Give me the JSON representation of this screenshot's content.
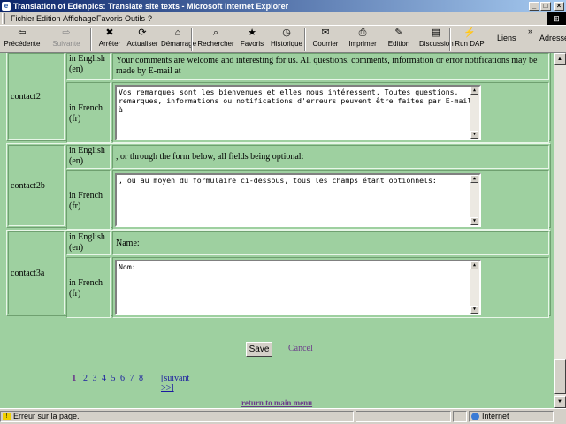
{
  "window": {
    "title": "Translation of Edenpics: Translate site texts - Microsoft Internet Explorer",
    "controls": {
      "minimize": "_",
      "maximize": "□",
      "close": "×"
    }
  },
  "menu": [
    "Fichier",
    "Edition",
    "Affichage",
    "Favoris",
    "Outils",
    "?"
  ],
  "toolbar": {
    "buttons": [
      {
        "label": "Précédente",
        "icon": "back-arrow-icon",
        "glyph": "⇦"
      },
      {
        "label": "Suivante",
        "icon": "forward-arrow-icon",
        "glyph": "⇨"
      },
      {
        "label": "Arrêter",
        "icon": "stop-icon",
        "glyph": "✖"
      },
      {
        "label": "Actualiser",
        "icon": "refresh-icon",
        "glyph": "⟳"
      },
      {
        "label": "Démarrage",
        "icon": "home-icon",
        "glyph": "⌂"
      },
      {
        "label": "Rechercher",
        "icon": "search-icon",
        "glyph": "⌕"
      },
      {
        "label": "Favoris",
        "icon": "favorites-icon",
        "glyph": "★"
      },
      {
        "label": "Historique",
        "icon": "history-icon",
        "glyph": "◷"
      },
      {
        "label": "Courrier",
        "icon": "mail-icon",
        "glyph": "✉"
      },
      {
        "label": "Imprimer",
        "icon": "print-icon",
        "glyph": "⎙"
      },
      {
        "label": "Edition",
        "icon": "edit-icon",
        "glyph": "✎"
      },
      {
        "label": "Discussion",
        "icon": "discussion-icon",
        "glyph": "▤"
      },
      {
        "label": "Run DAP",
        "icon": "run-dap-icon",
        "glyph": "⚡"
      }
    ],
    "links_label": "Liens",
    "chevron": "»",
    "address_label": "Adresse"
  },
  "rows": [
    {
      "key": "contact2",
      "en_label": "in English (en)",
      "fr_label": "in French (fr)",
      "en_text": "Your comments are welcome and interesting for us. All questions, comments, information or error notifications may be made by E-mail at",
      "fr_text": "Vos remarques sont les bienvenues et elles nous intéressent. Toutes questions, remarques, informations ou notifications d'erreurs peuvent être faites par E-mail à"
    },
    {
      "key": "contact2b",
      "en_label": "in English (en)",
      "fr_label": "in French (fr)",
      "en_text": ", or through the form below, all fields being optional:",
      "fr_text": ", ou au moyen du formulaire ci-dessous, tous les champs étant optionnels:"
    },
    {
      "key": "contact3a",
      "en_label": "in English (en)",
      "fr_label": "in French (fr)",
      "en_text": "Name:",
      "fr_text": "Nom:"
    }
  ],
  "actions": {
    "save": "Save",
    "cancel": "Cancel"
  },
  "pagination": {
    "current": "1",
    "pages": [
      "2",
      "3",
      "4",
      "5",
      "6",
      "7",
      "8"
    ],
    "next": "[suivant >>]"
  },
  "return_link": "return to main menu",
  "status": {
    "message": "Erreur sur la page.",
    "zone": "Internet"
  }
}
